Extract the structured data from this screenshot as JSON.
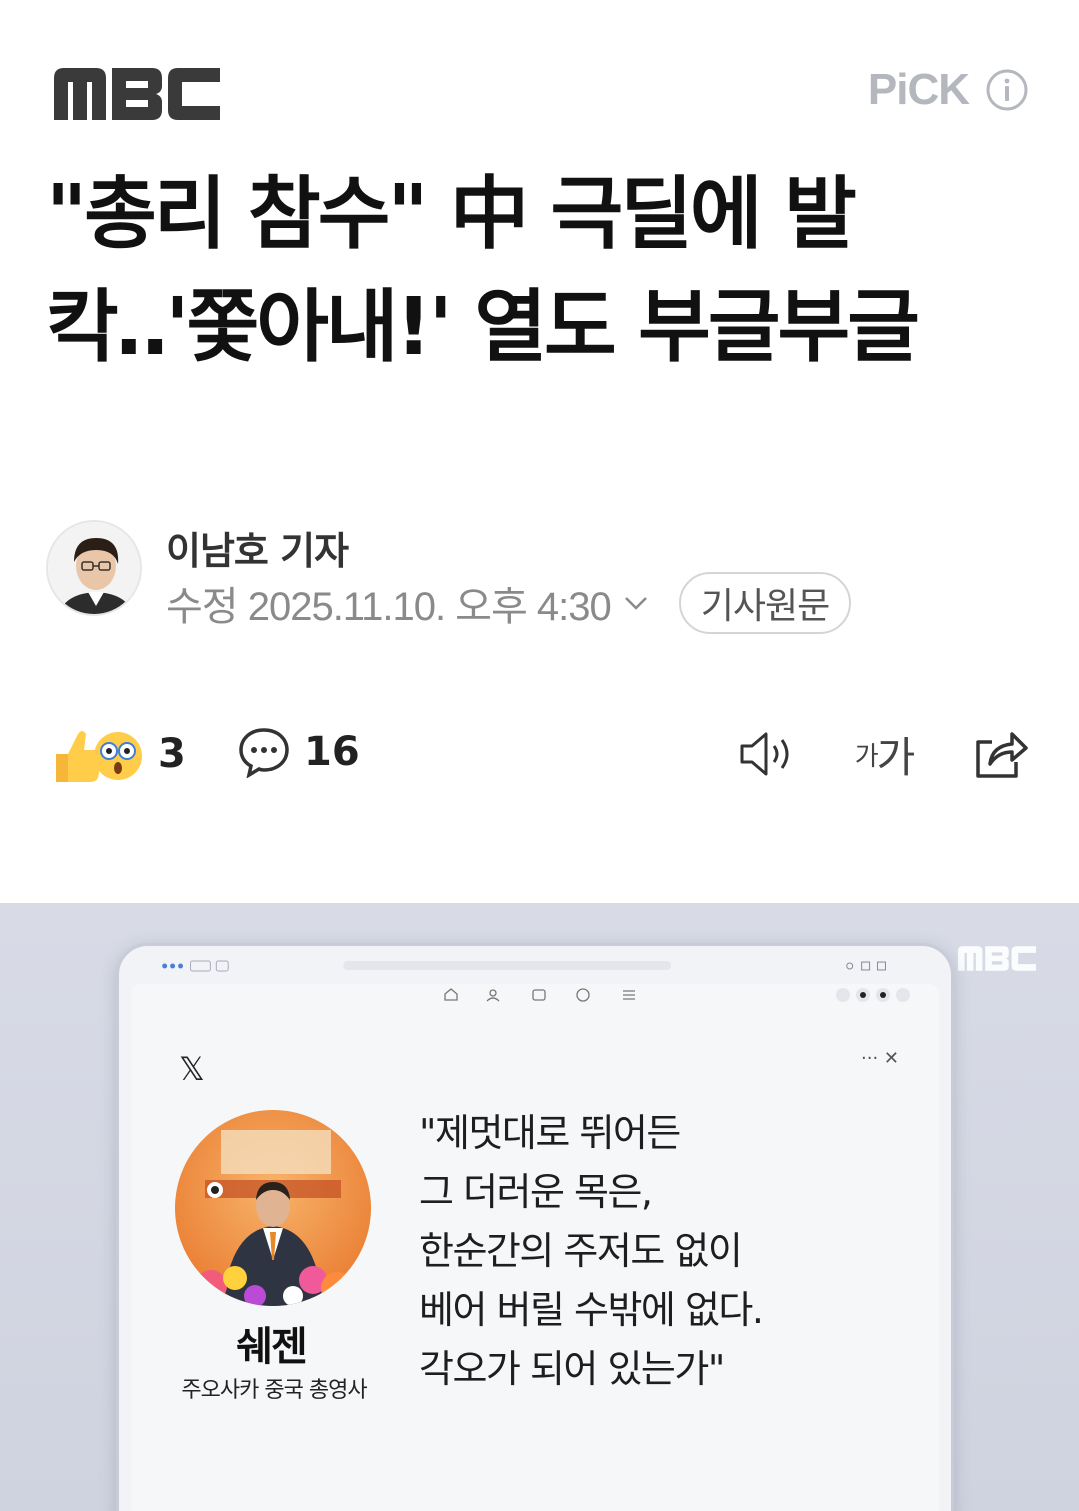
{
  "header": {
    "logo": "MBC",
    "pick_label": "PiCK"
  },
  "article": {
    "headline": "\"총리 참수\" 中 극딜에 발칵‥'쫓아내!' 열도 부글부글",
    "reporter": "이남호 기자",
    "date": "수정 2025.11.10. 오후 4:30",
    "origin_button": "기사원문"
  },
  "actions": {
    "reaction_count": "3",
    "comment_count": "16",
    "font_size_label_small": "가",
    "font_size_label_large": "가"
  },
  "media": {
    "broadcaster_logo": "MBC",
    "platform_logo": "𝕏",
    "post_controls": "··· ✕",
    "person_name": "쉐젠",
    "person_title": "주오사카 중국 총영사",
    "quote_lines": [
      "\"제멋대로 뛰어든",
      "그 더러운 목은,",
      "한순간의 주저도 없이",
      "베어 버릴 수밖에 없다.",
      "각오가 되어 있는가\""
    ]
  },
  "colors": {
    "logo": "#3a3a3a",
    "pick": "#b4b7bd",
    "meta_gray": "#8a8a8a",
    "media_bg": "#d8dbe6",
    "accent_orange": "#e8772c"
  },
  "icons": {
    "reaction_icons": [
      "thumbs-up-icon",
      "surprised-face-icon"
    ],
    "comment": "speech-bubble-icon",
    "tts": "speaker-icon",
    "share": "share-icon",
    "info": "info-icon",
    "date_toggle": "chevron-down-icon"
  }
}
